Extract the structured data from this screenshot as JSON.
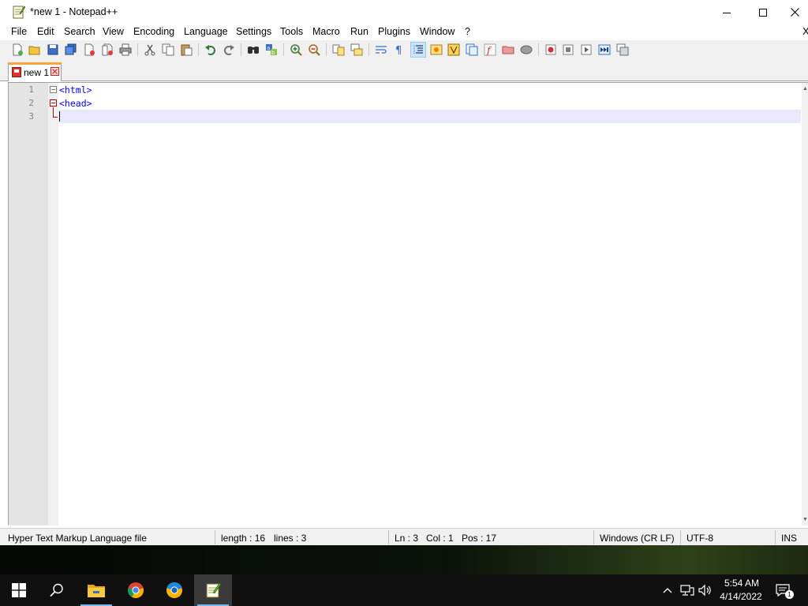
{
  "window": {
    "title": "*new 1 - Notepad++",
    "controls": {
      "minimize": "minimize",
      "maximize": "maximize",
      "close": "close"
    }
  },
  "menu": {
    "items": [
      "File",
      "Edit",
      "Search",
      "View",
      "Encoding",
      "Language",
      "Settings",
      "Tools",
      "Macro",
      "Run",
      "Plugins",
      "Window",
      "?"
    ],
    "close_glyph": "X"
  },
  "toolbar": {
    "buttons": [
      "new-file",
      "open-file",
      "save",
      "save-all",
      "close",
      "close-all",
      "print",
      "cut",
      "copy",
      "paste",
      "undo",
      "redo",
      "find",
      "replace",
      "zoom-in",
      "zoom-out",
      "sync-vertical",
      "sync-horizontal",
      "word-wrap",
      "show-all-characters",
      "indent-guide",
      "user-defined-language",
      "document-map",
      "function-list",
      "folder-as-workspace",
      "monitoring",
      "record-macro",
      "stop-recording",
      "playback-macro",
      "run-macro-multiple",
      "save-macro"
    ],
    "active_button": "indent-guide"
  },
  "tabs": [
    {
      "label": "new 1",
      "active": true,
      "modified": true
    }
  ],
  "editor": {
    "lines": [
      {
        "number": "1",
        "text": "<html>"
      },
      {
        "number": "2",
        "text": "<head>"
      },
      {
        "number": "3",
        "text": ""
      }
    ],
    "current_line": 3,
    "colors": {
      "tag": "#0000ff",
      "line_number": "#808080",
      "current_line_bg": "#e8e8ff",
      "fold_marker": "#c00000"
    }
  },
  "status": {
    "file_type": "Hyper Text Markup Language file",
    "length": "length : 16",
    "lines": "lines : 3",
    "ln": "Ln : 3",
    "col": "Col : 1",
    "pos": "Pos : 17",
    "eol": "Windows (CR LF)",
    "encoding": "UTF-8",
    "mode": "INS"
  },
  "taskbar": {
    "apps": [
      "start",
      "search",
      "file-explorer",
      "chrome",
      "brave",
      "notepad-plus-plus"
    ],
    "active_app": "notepad-plus-plus",
    "tray": [
      "show-hidden-icons",
      "network",
      "volume"
    ],
    "time": "5:54 AM",
    "date": "4/14/2022",
    "notifications": "1"
  }
}
